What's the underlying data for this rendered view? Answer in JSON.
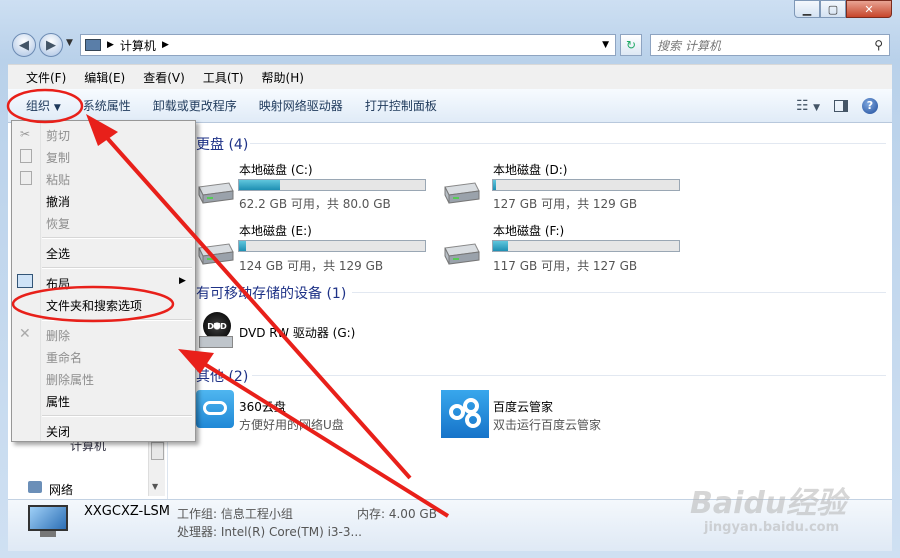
{
  "window": {
    "address_path": "计算机",
    "search_placeholder": "搜索 计算机"
  },
  "menubar": [
    "文件(F)",
    "编辑(E)",
    "查看(V)",
    "工具(T)",
    "帮助(H)"
  ],
  "command_bar": {
    "organize": "组织",
    "items": [
      "系统属性",
      "卸载或更改程序",
      "映射网络驱动器",
      "打开控制面板"
    ]
  },
  "groups": {
    "hdd": "硬盘 (4)",
    "removable": "有可移动存储的设备 (1)",
    "other": "其他 (2)"
  },
  "group_visible": {
    "hdd": "更盘 (4)",
    "removable": "有可移动存储的设备 (1)",
    "other": "其他 (2)"
  },
  "drives": [
    {
      "name": "本地磁盘 (C:)",
      "info": "62.2 GB 可用，共 80.0 GB",
      "used_fraction": 0.22
    },
    {
      "name": "本地磁盘 (D:)",
      "info": "127 GB 可用，共 129 GB",
      "used_fraction": 0.015
    },
    {
      "name": "本地磁盘 (E:)",
      "info": "124 GB 可用，共 129 GB",
      "used_fraction": 0.04
    },
    {
      "name": "本地磁盘 (F:)",
      "info": "117 GB 可用，共 127 GB",
      "used_fraction": 0.08
    }
  ],
  "dvd": {
    "name": "DVD RW 驱动器 (G:)",
    "label": "DVD"
  },
  "others": [
    {
      "name": "360云盘",
      "desc": "方便好用的网络U盘"
    },
    {
      "name": "百度云管家",
      "desc": "双击运行百度云管家"
    }
  ],
  "context_menu": {
    "items": [
      {
        "label": "剪切",
        "disabled": true
      },
      {
        "label": "复制",
        "disabled": true
      },
      {
        "label": "粘贴",
        "disabled": true
      },
      {
        "label": "撤消",
        "disabled": false
      },
      {
        "label": "恢复",
        "disabled": true
      },
      {
        "label": "全选",
        "disabled": false
      },
      {
        "label": "布局",
        "disabled": false
      },
      {
        "label": "文件夹和搜索选项",
        "disabled": false
      },
      {
        "label": "删除",
        "disabled": true
      },
      {
        "label": "重命名",
        "disabled": true
      },
      {
        "label": "删除属性",
        "disabled": true
      },
      {
        "label": "属性",
        "disabled": false
      },
      {
        "label": "关闭",
        "disabled": false
      }
    ]
  },
  "sidebar": {
    "computer_label": "计算机",
    "network_label": "网络"
  },
  "status": {
    "computer_name": "XXGCXZ-LSM",
    "workgroup": "工作组: 信息工程小组",
    "memory": "内存: 4.00 GB",
    "processor": "处理器: Intel(R) Core(TM) i3-3..."
  },
  "watermark": {
    "brand": "Baidu经验",
    "url": "jingyan.baidu.com"
  },
  "colors": {
    "annotation": "#e8201a",
    "accent": "#1e3287"
  }
}
